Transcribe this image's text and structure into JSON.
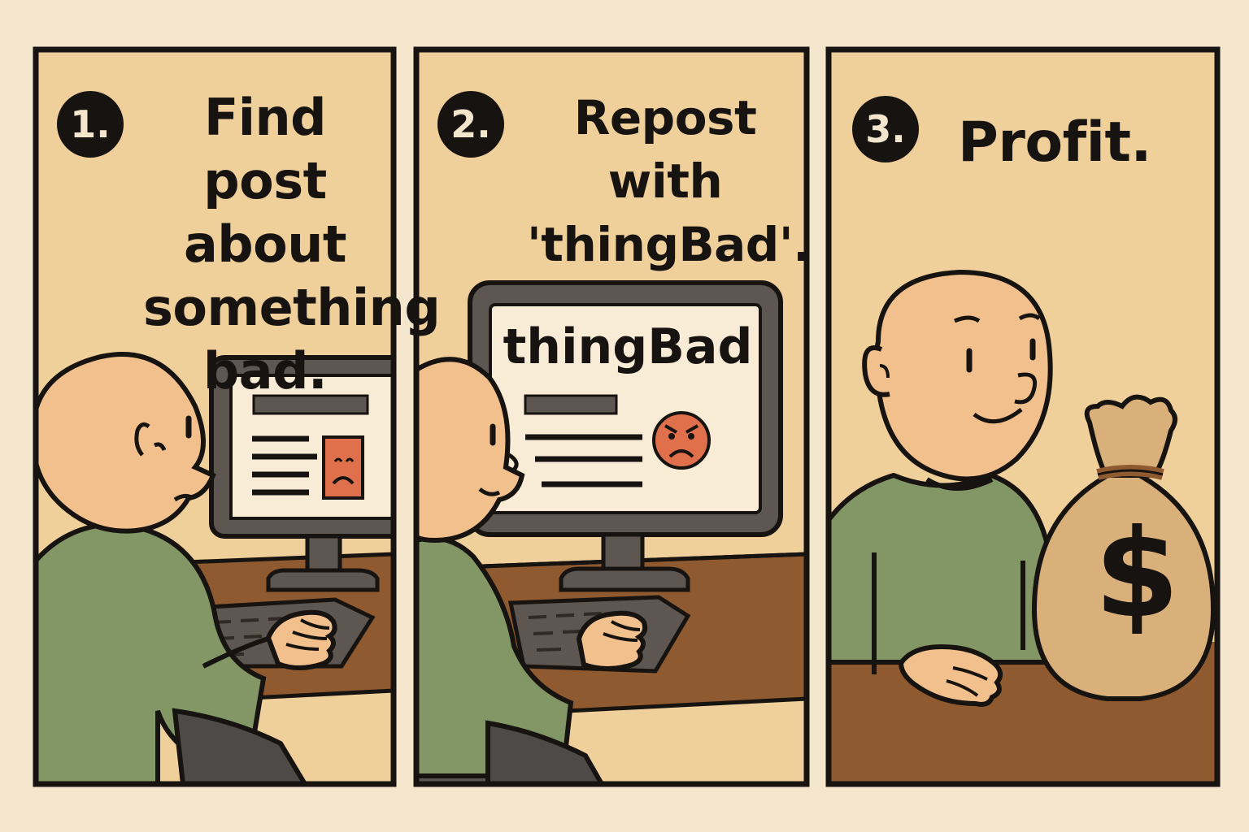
{
  "panels": [
    {
      "number": "1.",
      "caption_lines": [
        "Find post",
        "about",
        "something",
        "bad."
      ]
    },
    {
      "number": "2.",
      "caption_lines": [
        "Repost with",
        "'thingBad'."
      ],
      "screen_text": "thingBad"
    },
    {
      "number": "3.",
      "caption_lines": [
        "Profit."
      ],
      "bag_symbol": "$"
    }
  ],
  "colors": {
    "page_background": "#f3e6cc",
    "panel_background": "#efcf9a",
    "skin": "#f2c08c",
    "shirt": "#829666",
    "desk": "#8f5a30",
    "monitor": "#5e5650",
    "screen": "#f8ecd6",
    "sad_emoji": "#e0704c",
    "money_bag": "#d9b07a",
    "outline": "#161310"
  },
  "icons": [
    "sad-face-icon",
    "angry-face-icon",
    "money-bag-icon"
  ]
}
